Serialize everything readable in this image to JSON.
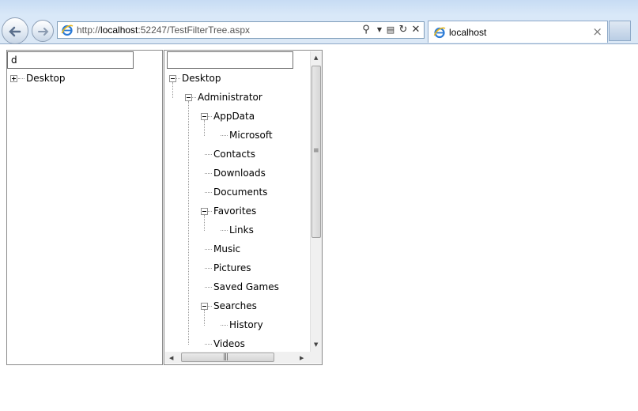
{
  "browser": {
    "address_prefix": "http://",
    "address_host": "localhost",
    "address_rest": ":52247/TestFilterTree.aspx",
    "tab_title": "localhost",
    "tab_close_glyph": "×",
    "icons": [
      "back-arrow-icon",
      "forward-arrow-icon",
      "ie-icon",
      "search-icon",
      "dropdown-icon",
      "compatibility-icon",
      "refresh-icon",
      "stop-icon",
      "close-icon"
    ]
  },
  "left_panel": {
    "filter_value": "d",
    "tree": [
      {
        "label": "Desktop",
        "expanded": false
      }
    ]
  },
  "right_panel": {
    "filter_value": "",
    "tree": [
      {
        "label": "Desktop",
        "level": 0,
        "expander": "minus"
      },
      {
        "label": "Administrator",
        "level": 1,
        "expander": "minus"
      },
      {
        "label": "AppData",
        "level": 2,
        "expander": "minus"
      },
      {
        "label": "Microsoft",
        "level": 3,
        "expander": null
      },
      {
        "label": "Contacts",
        "level": 2,
        "expander": null
      },
      {
        "label": "Downloads",
        "level": 2,
        "expander": null
      },
      {
        "label": "Documents",
        "level": 2,
        "expander": null
      },
      {
        "label": "Favorites",
        "level": 2,
        "expander": "minus"
      },
      {
        "label": "Links",
        "level": 3,
        "expander": null
      },
      {
        "label": "Music",
        "level": 2,
        "expander": null
      },
      {
        "label": "Pictures",
        "level": 2,
        "expander": null
      },
      {
        "label": "Saved Games",
        "level": 2,
        "expander": null
      },
      {
        "label": "Searches",
        "level": 2,
        "expander": "minus"
      },
      {
        "label": "History",
        "level": 3,
        "expander": null
      },
      {
        "label": "Videos",
        "level": 2,
        "expander": null
      }
    ]
  },
  "colors": {
    "chrome_bg": "#d9e8f8",
    "border": "#8a8a8a",
    "tree_line": "#999999"
  }
}
